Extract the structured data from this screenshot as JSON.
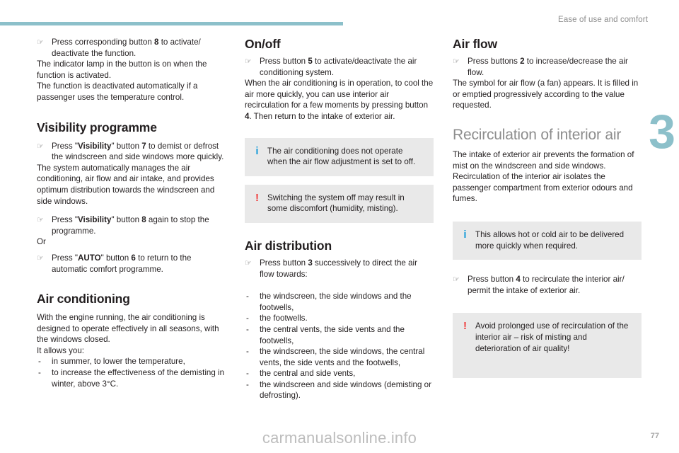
{
  "header": {
    "running_head": "Ease of use and comfort",
    "chapter_number": "3",
    "rule_color": "#8cc0ca"
  },
  "footer": {
    "watermark": "carmanualsonline.info",
    "page_number": "77"
  },
  "icons": {
    "hand": "☞",
    "dash": "-",
    "info": "i",
    "warning": "!"
  },
  "colors": {
    "teal": "#8cc0ca",
    "info_blue": "#1b9dd9",
    "warning_red": "#f03a3a",
    "box_grey": "#e9e9e9",
    "heading_grey": "#8d8d8d"
  },
  "left_column": {
    "action_1": {
      "pre": "Press corresponding button ",
      "bold": "8",
      "post": " to activate/ deactivate the function."
    },
    "para_1": "The indicator lamp in the button is on when the function is activated.",
    "para_2": "The function is deactivated automatically if a passenger uses the temperature control.",
    "heading_visibility": "Visibility programme",
    "action_2": {
      "pre": "Press \"",
      "bold_1": "Visibility",
      "mid": "\" button ",
      "bold_2": "7",
      "post": " to demist or defrost the windscreen and side windows more quickly."
    },
    "para_3": "The system automatically manages the air conditioning, air flow and air intake, and provides optimum distribution towards the windscreen and side windows.",
    "action_3": {
      "pre": "Press \"",
      "bold_1": "Visibility",
      "mid": "\" button ",
      "bold_2": "8",
      "post": " again to stop the programme."
    },
    "or_text": "Or",
    "action_4": {
      "pre": "Press \"",
      "bold_1": "AUTO",
      "mid": "\" button ",
      "bold_2": "6",
      "post": " to return to the automatic comfort programme."
    },
    "heading_ac": "Air conditioning",
    "para_4": "With the engine running, the air conditioning is designed to operate effectively in all seasons, with the windows closed.",
    "para_5": "It allows you:",
    "list_1": [
      "in summer, to lower the temperature,",
      "to increase the effectiveness of the demisting in winter, above 3°C."
    ]
  },
  "middle_column": {
    "heading_onoff": "On/off",
    "action_1": {
      "pre": "Press button ",
      "bold": "5",
      "post": " to activate/deactivate the air conditioning system."
    },
    "para_1_a": "When the air conditioning is in operation, to cool the air more quickly, you can use interior air recirculation for a few moments by pressing button ",
    "para_1_bold": "4",
    "para_1_b": ". Then return to the intake of exterior air.",
    "info_box": "The air conditioning does not operate when the air flow adjustment is set to off.",
    "warning_box": "Switching the system off may result in some discomfort (humidity, misting).",
    "heading_distribution": "Air distribution",
    "action_2": {
      "pre": "Press button ",
      "bold": "3",
      "post": " successively to direct the air flow towards:"
    },
    "list_1": [
      "the windscreen, the side windows and the footwells,",
      "the footwells.",
      "the central vents, the side vents and the footwells,",
      "the windscreen, the side windows, the central vents, the side vents and the footwells,",
      "the central and side vents,",
      "the windscreen and side windows (demisting or defrosting)."
    ]
  },
  "right_column": {
    "heading_airflow": "Air flow",
    "action_1": {
      "pre": "Press buttons ",
      "bold": "2",
      "post": " to increase/decrease the air flow."
    },
    "para_1": "The symbol for air flow (a fan) appears. It is filled in or emptied progressively according to the value requested.",
    "heading_recirculation": "Recirculation of interior air",
    "para_2": "The intake of exterior air prevents the formation of mist on the windscreen and side windows. Recirculation of the interior air isolates the passenger compartment from exterior odours and fumes.",
    "info_box": "This allows hot or cold air to be delivered more quickly when required.",
    "action_2": {
      "pre": "Press button ",
      "bold": "4",
      "post": " to recirculate the interior air/ permit the intake of exterior air."
    },
    "warning_box": "Avoid prolonged use of recirculation of the interior air – risk of misting and deterioration of air quality!"
  }
}
